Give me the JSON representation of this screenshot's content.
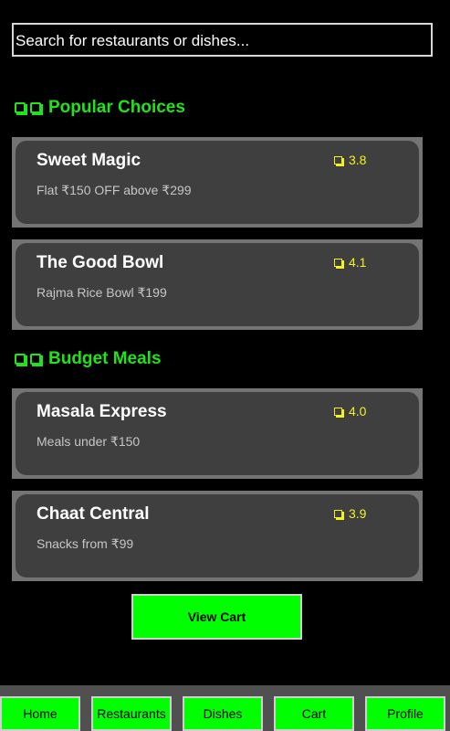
{
  "search": {
    "placeholder": "Search for restaurants or dishes..."
  },
  "sections": [
    {
      "title": "Popular Choices",
      "icon": "box-icon",
      "cards": [
        {
          "name": "Sweet Magic",
          "description": "Flat ₹150 OFF above ₹299",
          "rating": "3.8"
        },
        {
          "name": "The Good Bowl",
          "description": "Rajma Rice Bowl ₹199",
          "rating": "4.1"
        }
      ]
    },
    {
      "title": "Budget Meals",
      "icon": "box-icon",
      "cards": [
        {
          "name": "Masala Express",
          "description": "Meals under ₹150",
          "rating": "4.0"
        },
        {
          "name": "Chaat Central",
          "description": "Snacks from ₹99",
          "rating": "3.9"
        }
      ]
    }
  ],
  "view_cart_label": "View Cart",
  "nav": {
    "items": [
      {
        "label": "Home"
      },
      {
        "label": "Restaurants"
      },
      {
        "label": "Dishes"
      },
      {
        "label": "Cart"
      },
      {
        "label": "Profile"
      }
    ]
  },
  "colors": {
    "background": "#000000",
    "section_title": "#22e21b",
    "card_frame": "#747474",
    "card_body": "#3f3f3f",
    "rating": "#f2f21e",
    "button": "#00ff00",
    "nav_bar": "#505050"
  }
}
